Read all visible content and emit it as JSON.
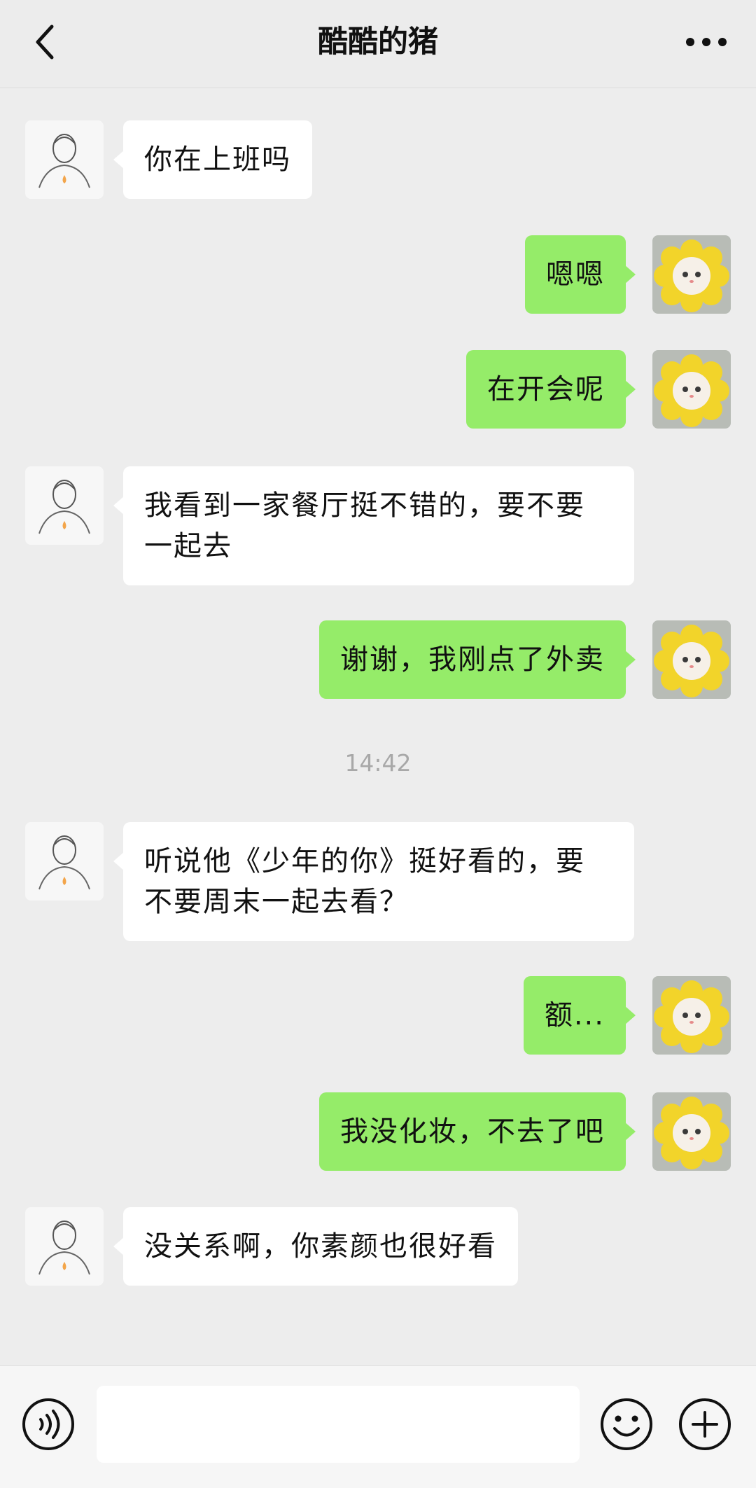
{
  "header": {
    "title": "酷酷的猪",
    "back_icon": "chevron-left-icon",
    "more_icon": "more-dots-icon"
  },
  "timestamp": "14:42",
  "messages": [
    {
      "side": "in",
      "text": "你在上班吗"
    },
    {
      "side": "out",
      "text": "嗯嗯"
    },
    {
      "side": "out",
      "text": "在开会呢"
    },
    {
      "side": "in",
      "text": "我看到一家餐厅挺不错的，要不要一起去"
    },
    {
      "side": "out",
      "text": "谢谢，我刚点了外卖"
    },
    {
      "side": "in",
      "text": "听说他《少年的你》挺好看的，要不要周末一起去看？"
    },
    {
      "side": "out",
      "text": "额..."
    },
    {
      "side": "out",
      "text": "我没化妆，不去了吧"
    },
    {
      "side": "in",
      "text": "没关系啊，你素颜也很好看"
    }
  ],
  "input_bar": {
    "voice_icon": "voice-icon",
    "emoji_icon": "emoji-icon",
    "plus_icon": "plus-icon",
    "placeholder": ""
  },
  "colors": {
    "background": "#ededed",
    "bubble_out": "#95ec69",
    "bubble_in": "#ffffff",
    "timestamp": "#a8a8a8"
  }
}
